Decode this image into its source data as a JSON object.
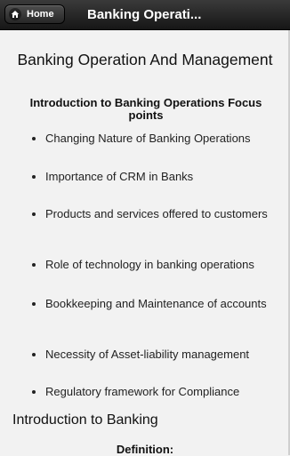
{
  "header": {
    "home_label": "Home",
    "home_icon": "home-icon",
    "title": "Banking Operati..."
  },
  "main": {
    "title": "Banking Operation And Management",
    "section_heading": "Introduction to Banking Operations Focus points",
    "bullets": [
      "Changing Nature of Banking Operations",
      "Importance of CRM in Banks",
      "Products and services offered to customers",
      "Role of technology in banking operations",
      "Bookkeeping and Maintenance of accounts",
      "Necessity of Asset-liability management",
      "Regulatory framework for Compliance"
    ],
    "intro_heading": "Introduction to Banking",
    "definition_label": "Definition:"
  }
}
